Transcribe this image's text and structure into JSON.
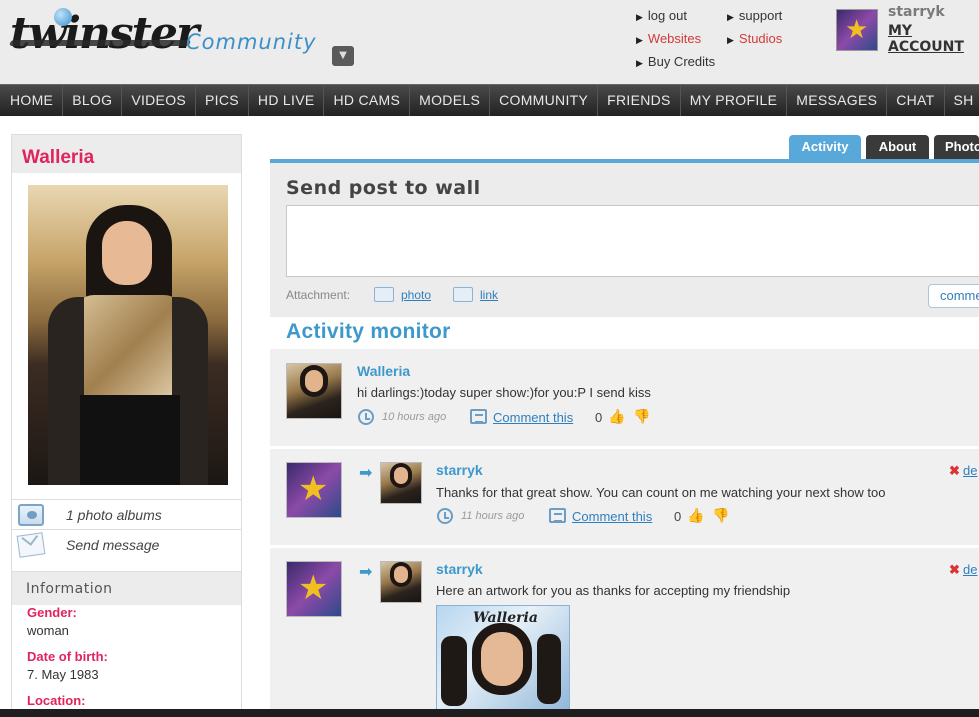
{
  "header": {
    "logo_text": "twinster",
    "community_label": "Community",
    "links_col1": [
      "log out",
      "Websites",
      "Buy Credits"
    ],
    "links_col2": [
      "support",
      "Studios"
    ],
    "account_name": "starryk",
    "my_account_label": "MY ACCOUNT"
  },
  "nav": {
    "items": [
      "HOME",
      "BLOG",
      "VIDEOS",
      "PICS",
      "HD LIVE",
      "HD CAMS",
      "MODELS",
      "COMMUNITY",
      "FRIENDS",
      "MY PROFILE",
      "MESSAGES",
      "CHAT",
      "SH"
    ]
  },
  "profile": {
    "name": "Walleria",
    "photo_albums_label": "1 photo albums",
    "send_message_label": "Send message",
    "info_title": "Information",
    "fields": [
      {
        "label": "Gender:",
        "value": "woman"
      },
      {
        "label": "Date of birth:",
        "value": "7. May 1983"
      },
      {
        "label": "Location:",
        "value": ""
      }
    ]
  },
  "tabs": [
    "Activity",
    "About",
    "Photo"
  ],
  "post": {
    "title": "Send post to wall",
    "attachment_label": "Attachment:",
    "photo_label": "photo",
    "link_label": "link",
    "comment_button": "comment"
  },
  "activity": {
    "title": "Activity monitor",
    "comment_link": "Comment this",
    "delete_label": "de",
    "items": [
      {
        "user": "Walleria",
        "text": "hi darlings:)today super show:)for you:P I send kiss",
        "time": "10 hours ago",
        "likes": "0"
      },
      {
        "user": "starryk",
        "text": "Thanks for that great show. You can count on me watching your next show too",
        "time": "11 hours ago",
        "likes": "0"
      },
      {
        "user": "starryk",
        "text": "Here an artwork for you as thanks for accepting my friendship",
        "artwork_title": "Walleria"
      }
    ]
  },
  "colors": {
    "accent_blue": "#3d98cc",
    "tab_blue": "#58a9d9",
    "profile_pink": "#e0245e",
    "link_red": "#d23a3a",
    "nav_dark": "#2a2a2a"
  }
}
